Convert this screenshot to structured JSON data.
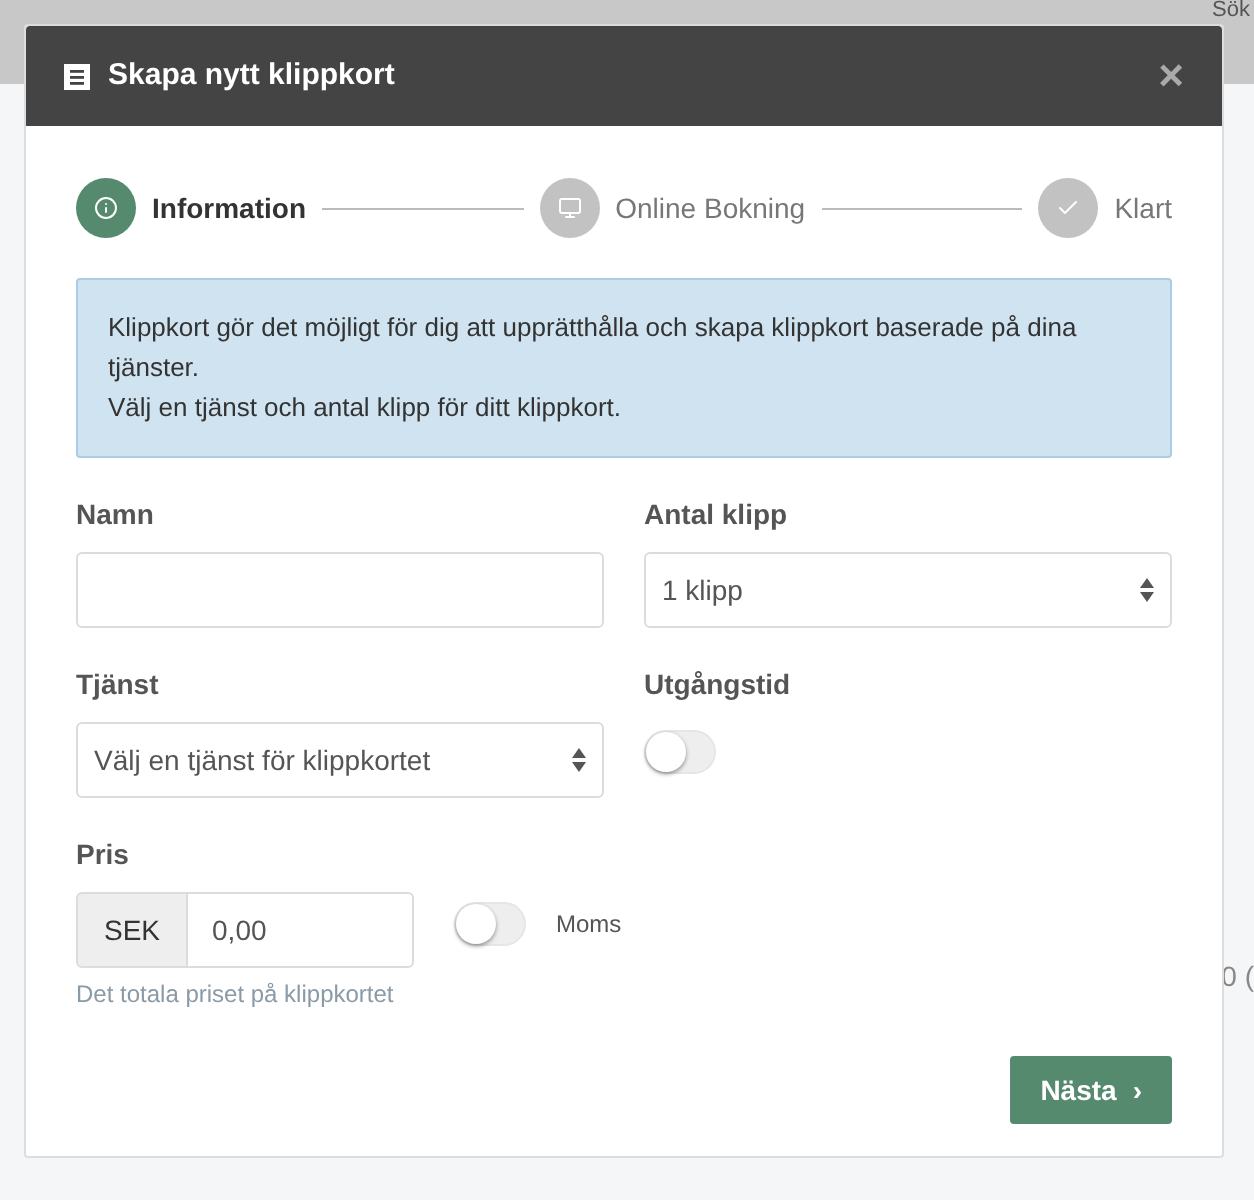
{
  "background": {
    "search_text": "Sök",
    "cell_text": "0 ("
  },
  "dialog": {
    "title": "Skapa nytt klippkort",
    "close": "×"
  },
  "steps": [
    {
      "label": "Information",
      "kind": "info",
      "selected": true
    },
    {
      "label": "Online Bokning",
      "kind": "screen",
      "selected": false
    },
    {
      "label": "Klart",
      "kind": "check",
      "selected": false
    }
  ],
  "info_box": {
    "lines": [
      "Klippkort gör det möjligt för dig att upprätthålla och skapa klippkort baserade på dina tjänster.",
      "Välj en tjänst och antal klipp för ditt klippkort."
    ]
  },
  "form": {
    "name": {
      "label": "Namn"
    },
    "clips": {
      "label": "Antal klipp",
      "value": "1 klipp"
    },
    "service": {
      "label": "Tjänst",
      "value": "Välj en tjänst för klippkortet"
    },
    "expiry": {
      "label": "Utgångstid",
      "on": false
    },
    "price": {
      "label": "Pris",
      "currency": "SEK",
      "value": "0,00",
      "help": "Det totala priset på klippkortet"
    },
    "vat": {
      "label": "Moms",
      "on": false
    }
  },
  "next_button": {
    "label": "Nästa",
    "arrow": "›"
  }
}
